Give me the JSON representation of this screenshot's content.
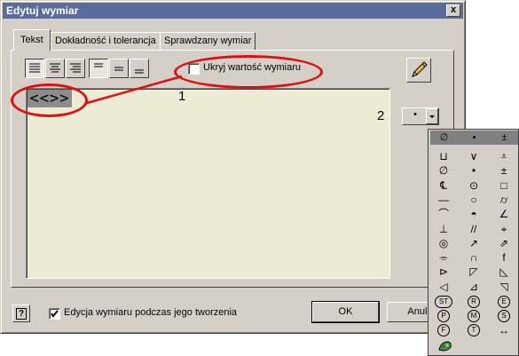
{
  "window": {
    "title": "Edytuj wymiar",
    "close_glyph": "x"
  },
  "tabs": [
    {
      "label": "Tekst",
      "active": true
    },
    {
      "label": "Dokładność i tolerancja",
      "active": false
    },
    {
      "label": "Sprawdzany wymiar",
      "active": false
    }
  ],
  "toolbar": {
    "align_buttons": [
      "align-left-icon",
      "align-center-icon",
      "align-right-icon"
    ],
    "valign_buttons": [
      "align-top-icon",
      "align-middle-icon",
      "align-bottom-icon"
    ],
    "hide_value_label": "Ukryj wartość wymiaru",
    "hide_value_checked": false,
    "edit_icon": "pencil-icon"
  },
  "editor": {
    "token": "<<>>"
  },
  "annotations": {
    "marker_1": "1",
    "marker_2": "2",
    "ellipse_color": "#e01010"
  },
  "symbol_dropdown": {
    "selected": "•"
  },
  "palette": {
    "header": [
      "∅",
      "•",
      "±"
    ],
    "rows": [
      [
        "⊔",
        "∨",
        "⩡"
      ],
      [
        "∅",
        "•",
        "±"
      ],
      [
        "℄",
        "⊙",
        "□"
      ],
      [
        "—",
        "○",
        "⌭"
      ],
      [
        "⌒",
        "◓",
        "∠"
      ],
      [
        "⊥",
        "//",
        "⌖"
      ],
      [
        "◎",
        "↗",
        "⇗"
      ],
      [
        "⌯",
        "∩",
        "f"
      ],
      [
        "⊳",
        "◸",
        "◺"
      ],
      [
        "◁",
        "⊿",
        "◹"
      ],
      [
        "ST",
        "R",
        "E"
      ],
      [
        "P",
        "M",
        "S"
      ],
      [
        "F",
        "T",
        "↔"
      ]
    ],
    "footer_icon": "palette-tool-icon"
  },
  "footer": {
    "help_label": "?",
    "edit_on_create_label": "Edycja wymiaru podczas jego tworzenia",
    "edit_on_create_checked": true,
    "ok_label": "OK",
    "cancel_label": "Anulu"
  },
  "colors": {
    "titlebar": "#5a6c9c",
    "dialog_bg": "#d4d0c8",
    "editor_bg": "#ecebd4",
    "annotation": "#e01010"
  }
}
